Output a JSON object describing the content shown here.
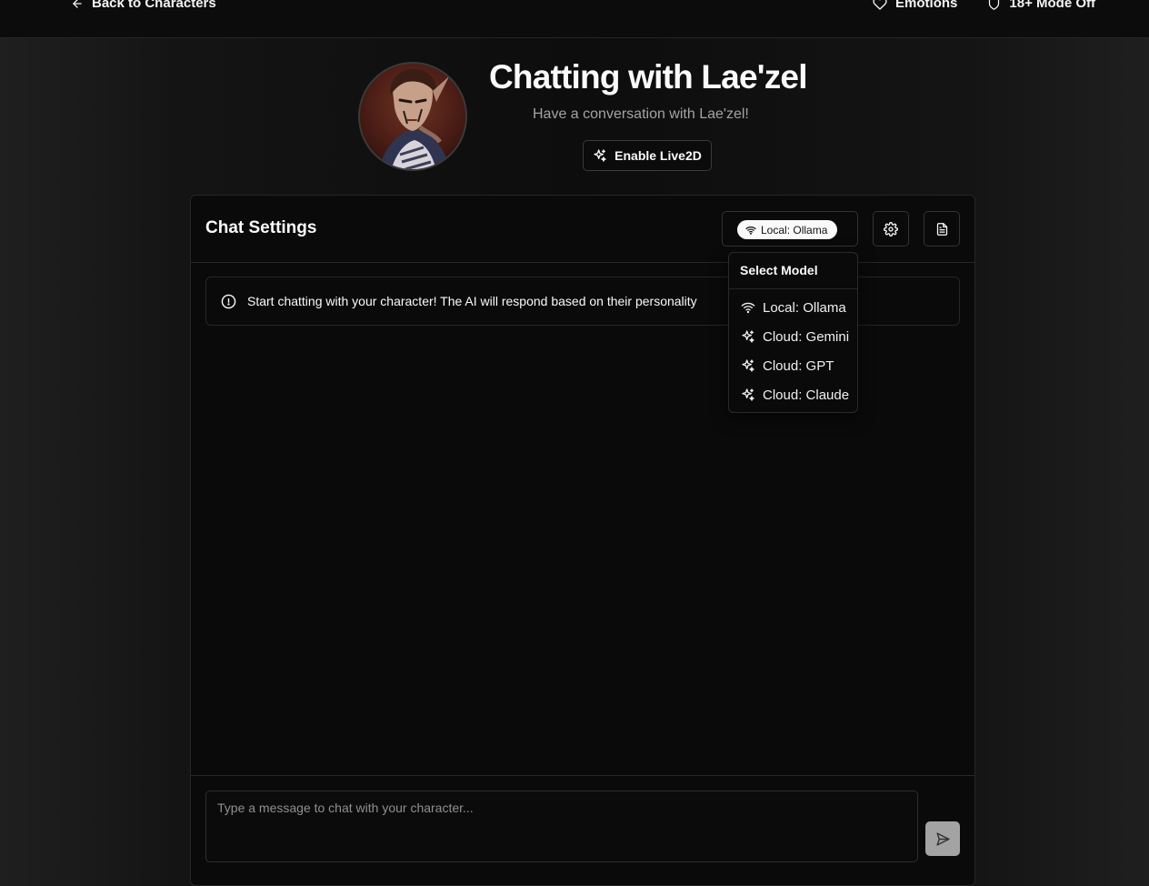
{
  "topbar": {
    "back_label": "Back to Characters",
    "emotions_label": "Emotions",
    "mode_label": "18+ Mode Off"
  },
  "header": {
    "title": "Chatting with Lae'zel",
    "subtitle": "Have a conversation with Lae'zel!",
    "live2d_label": "Enable Live2D",
    "avatar_alt": "Lae'zel"
  },
  "chat_settings": {
    "title": "Chat Settings",
    "current_model": "Local: Ollama"
  },
  "notice": {
    "text": "Start chatting with your character! The AI will respond based on their personality"
  },
  "model_menu": {
    "label": "Select Model",
    "items": [
      {
        "label": "Local: Ollama",
        "icon": "wifi-icon"
      },
      {
        "label": "Cloud: Gemini",
        "icon": "sparkles-icon"
      },
      {
        "label": "Cloud: GPT",
        "icon": "sparkles-icon"
      },
      {
        "label": "Cloud: Claude",
        "icon": "sparkles-icon"
      }
    ]
  },
  "composer": {
    "placeholder": "Type a message to chat with your character...",
    "value": ""
  },
  "colors": {
    "background": "#0a0a0a",
    "border": "#262626",
    "text": "#fafafa",
    "muted_text": "#a3a3a3",
    "pill_bg": "#fafafa",
    "send_button_bg": "#a3a3a3"
  }
}
